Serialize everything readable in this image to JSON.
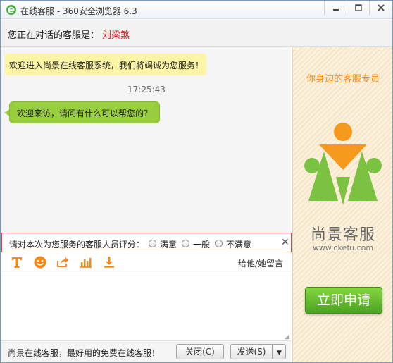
{
  "window": {
    "title": "在线客服 - 360安全浏览器 6.3",
    "icon": "browser-e-icon"
  },
  "agent_bar": {
    "label": "您正在对话的客服是：",
    "agent_name": "刘梁煞",
    "agent_name_color": "#d21e1e"
  },
  "chat": {
    "system_message": "欢迎进入尚景在线客服系统，我们将竭诚为您服务！",
    "timestamp": "17:25:43",
    "agent_message": "欢迎来访，请问有什么可以帮您的？"
  },
  "rating": {
    "prompt": "请对本次为您服务的客服人员评分：",
    "options": [
      "满意",
      "一般",
      "不满意"
    ],
    "selected": null
  },
  "toolbar": {
    "tools": [
      "font-icon",
      "emoji-icon",
      "share-icon",
      "chart-icon",
      "download-icon"
    ],
    "leave_message": "给他/她留言"
  },
  "input": {
    "value": ""
  },
  "bottom": {
    "slogan": "尚景在线客服，最好用的免费在线客服！",
    "close_label": "关闭(C)",
    "send_label": "发送(S)"
  },
  "ad": {
    "tagline": "你身边的客服专员",
    "brand": "尚景客服",
    "url": "www.ckefu.com",
    "apply_label": "立即申请"
  },
  "colors": {
    "accent_orange": "#f08a1c",
    "accent_green": "#7cc242",
    "bubble_yellow": "#fdf5a6",
    "bubble_green": "#99cf3f",
    "rating_border": "#d94343"
  }
}
